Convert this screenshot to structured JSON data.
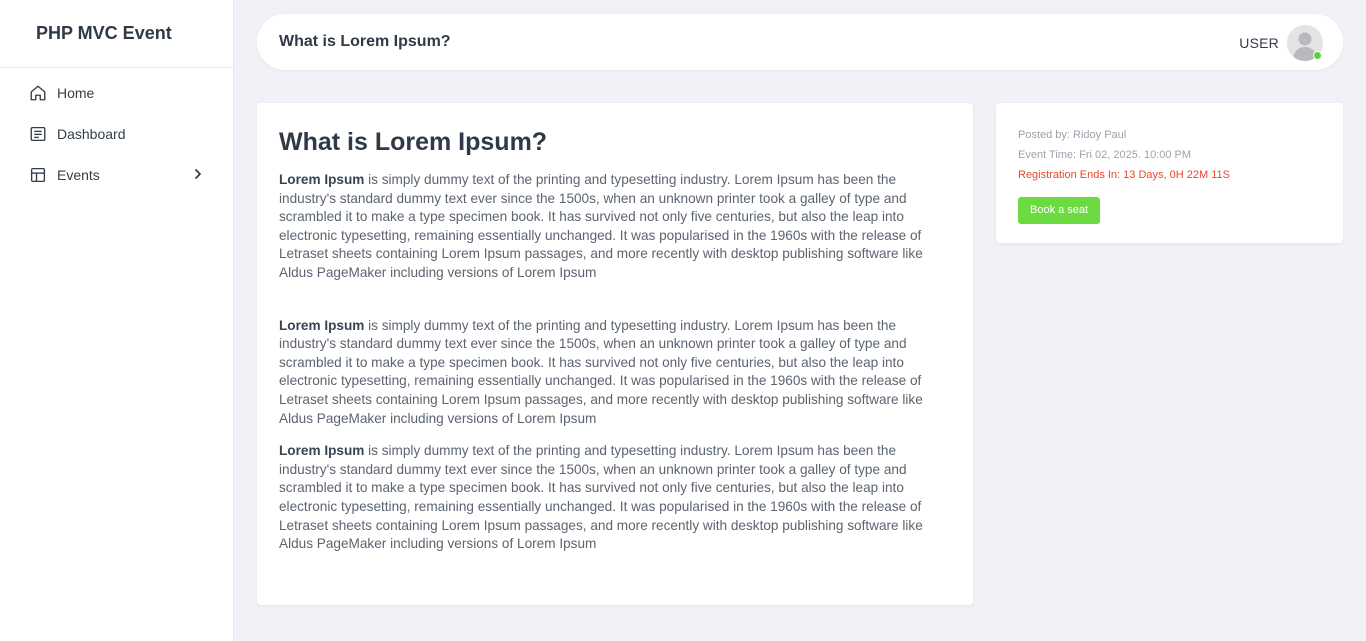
{
  "sidebar": {
    "brand": "PHP MVC Event",
    "items": [
      {
        "label": "Home",
        "icon": "home-icon"
      },
      {
        "label": "Dashboard",
        "icon": "dashboard-icon"
      },
      {
        "label": "Events",
        "icon": "layout-icon",
        "has_submenu": true
      }
    ]
  },
  "header": {
    "title": "What is Lorem Ipsum?",
    "user_label": "USER",
    "user_status_color": "#5fd13c"
  },
  "article": {
    "title": "What is Lorem Ipsum?",
    "paragraphs": [
      {
        "lead": "Lorem Ipsum",
        "text": " is simply dummy text of the printing and typesetting industry. Lorem Ipsum has been the industry's standard dummy text ever since the 1500s, when an unknown printer took a galley of type and scrambled it to make a type specimen book. It has survived not only five centuries, but also the leap into electronic typesetting, remaining essentially unchanged. It was popularised in the 1960s with the release of Letraset sheets containing Lorem Ipsum passages, and more recently with desktop publishing software like Aldus PageMaker including versions of Lorem Ipsum"
      },
      {
        "lead": "Lorem Ipsum",
        "text": " is simply dummy text of the printing and typesetting industry. Lorem Ipsum has been the industry's standard dummy text ever since the 1500s, when an unknown printer took a galley of type and scrambled it to make a type specimen book. It has survived not only five centuries, but also the leap into electronic typesetting, remaining essentially unchanged. It was popularised in the 1960s with the release of Letraset sheets containing Lorem Ipsum passages, and more recently with desktop publishing software like Aldus PageMaker including versions of Lorem Ipsum"
      },
      {
        "lead": "Lorem Ipsum",
        "text": " is simply dummy text of the printing and typesetting industry. Lorem Ipsum has been the industry's standard dummy text ever since the 1500s, when an unknown printer took a galley of type and scrambled it to make a type specimen book. It has survived not only five centuries, but also the leap into electronic typesetting, remaining essentially unchanged. It was popularised in the 1960s with the release of Letraset sheets containing Lorem Ipsum passages, and more recently with desktop publishing software like Aldus PageMaker including versions of Lorem Ipsum"
      }
    ]
  },
  "event_info": {
    "posted_by": "Posted by: Ridoy Paul",
    "event_time": "Event Time: Fri 02, 2025. 10:00 PM",
    "registration_ends": "Registration Ends In: 13 Days, 0H 22M 11S",
    "book_button": "Book a seat",
    "accent_color": "#6bdb41",
    "warning_color": "#e8472b"
  }
}
